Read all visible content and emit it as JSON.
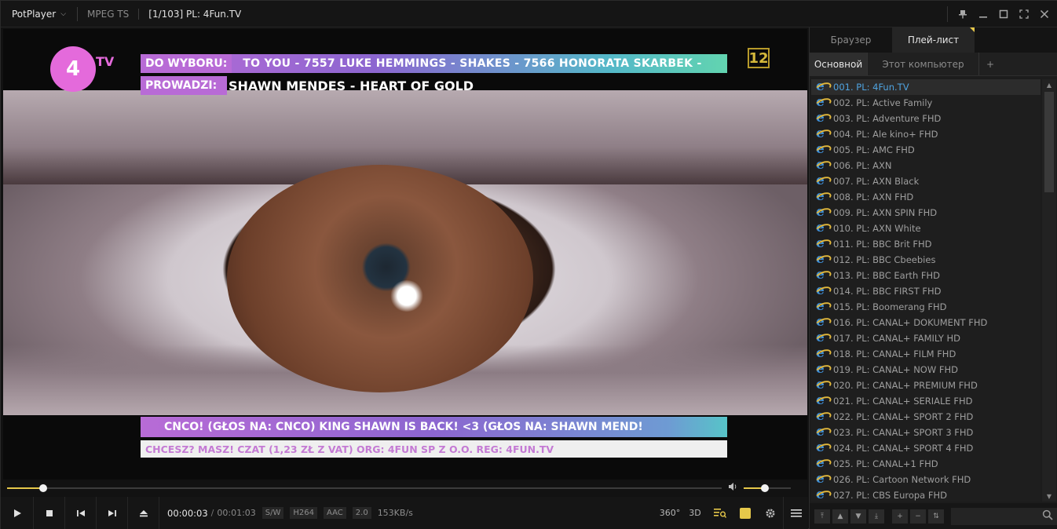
{
  "titlebar": {
    "app_name": "PotPlayer",
    "format": "MPEG TS",
    "title": "[1/103] PL: 4Fun.TV",
    "controls": [
      "pin-icon",
      "minimize-icon",
      "maximize-icon",
      "fullscreen-icon",
      "close-icon"
    ]
  },
  "video": {
    "logo": "4",
    "logo_sub": "TV",
    "ticker1_label": "DO WYBORU:",
    "ticker1_text": "TO YOU - 7557    LUKE HEMMINGS - SHAKES - 7566    HONORATA SKARBEK -",
    "ticker2_label": "PROWADZI:",
    "ticker2_text": "SHAWN MENDES - HEART OF GOLD",
    "age_rating": "12",
    "ticker3_text": "CNCO! (GŁOS NA: CNCO)        KING SHAWN IS BACK!  <3 (GŁOS NA: SHAWN MEND!",
    "ticker4_text": "CHCESZ? MASZ! CZAT (1,23 ZŁ Z VAT) ORG: 4FUN SP Z O.O. REG: 4FUN.TV"
  },
  "seek": {
    "progress": 0.05,
    "volume": 0.45
  },
  "controls": {
    "current_time": "00:00:03",
    "separator": "/",
    "duration": "00:01:03",
    "tags": [
      "S/W",
      "H264",
      "AAC",
      "2.0"
    ],
    "bitrate": "153KB/s",
    "label_360": "360°",
    "label_3d": "3D"
  },
  "playlist": {
    "top_tabs": [
      "Браузер",
      "Плей-лист"
    ],
    "sub_tabs": [
      "Основной",
      "Этот компьютер",
      "+"
    ],
    "items": [
      "001. PL: 4Fun.TV",
      "002. PL: Active Family",
      "003. PL: Adventure FHD",
      "004. PL: Ale kino+ FHD",
      "005. PL: AMC FHD",
      "006. PL: AXN",
      "007. PL: AXN Black",
      "008. PL: AXN FHD",
      "009. PL: AXN SPIN FHD",
      "010. PL: AXN White",
      "011. PL: BBC Brit FHD",
      "012. PL: BBC Cbeebies",
      "013. PL: BBC Earth FHD",
      "014. PL: BBC FIRST FHD",
      "015. PL: Boomerang FHD",
      "016. PL: CANAL+ DOKUMENT FHD",
      "017. PL: CANAL+ FAMILY HD",
      "018. PL: CANAL+ FILM FHD",
      "019. PL: CANAL+ NOW FHD",
      "020. PL: CANAL+ PREMIUM FHD",
      "021. PL: CANAL+ SERIALE FHD",
      "022. PL: CANAL+ SPORT 2 FHD",
      "023. PL: CANAL+ SPORT 3 FHD",
      "024. PL: CANAL+ SPORT 4 FHD",
      "025. PL: CANAL+1 FHD",
      "026. PL: Cartoon Network FHD",
      "027. PL: CBS Europa FHD"
    ],
    "selected_index": 0
  }
}
